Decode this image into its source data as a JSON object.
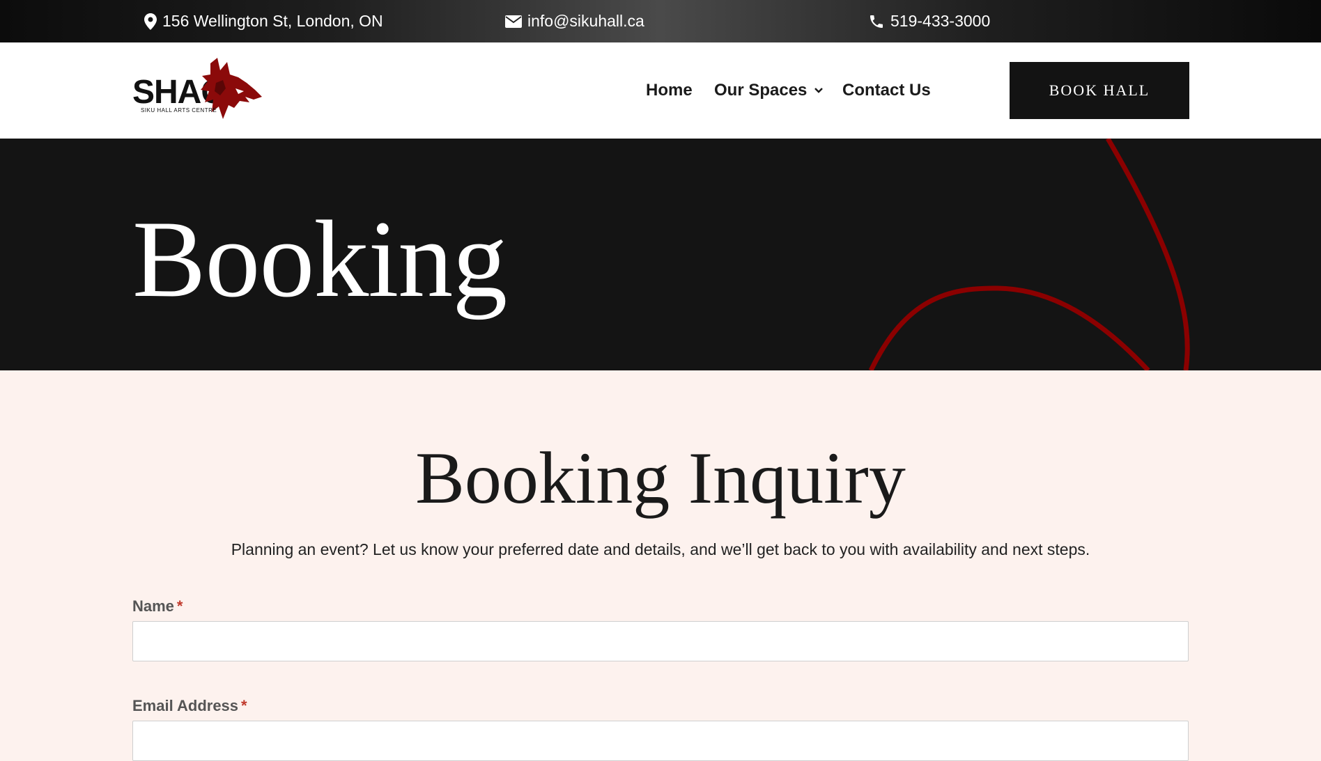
{
  "topbar": {
    "address": "156 Wellington St, London, ON",
    "email": "info@sikuhall.ca",
    "phone": "519-433-3000"
  },
  "logo": {
    "text": "SHAC",
    "subtitle": "SIKU HALL ARTS CENTRE"
  },
  "nav": {
    "home": "Home",
    "spaces": "Our Spaces",
    "contact": "Contact Us",
    "book_button": "BOOK HALL"
  },
  "hero": {
    "title": "Booking"
  },
  "form": {
    "heading": "Booking Inquiry",
    "lead": "Planning an event? Let us know your preferred date and details, and we’ll get back to you with availability and next steps.",
    "name_label": "Name",
    "email_label": "Email Address",
    "required_marker": "*",
    "name_value": "",
    "email_value": ""
  },
  "icons": {
    "address": "map-pin-icon",
    "email": "envelope-icon",
    "phone": "phone-icon",
    "spaces_dropdown": "chevron-down-icon"
  },
  "colors": {
    "accent_red": "#8b0000",
    "dark": "#141414",
    "page_bg": "#fdf2ee",
    "required": "#c0392b"
  }
}
